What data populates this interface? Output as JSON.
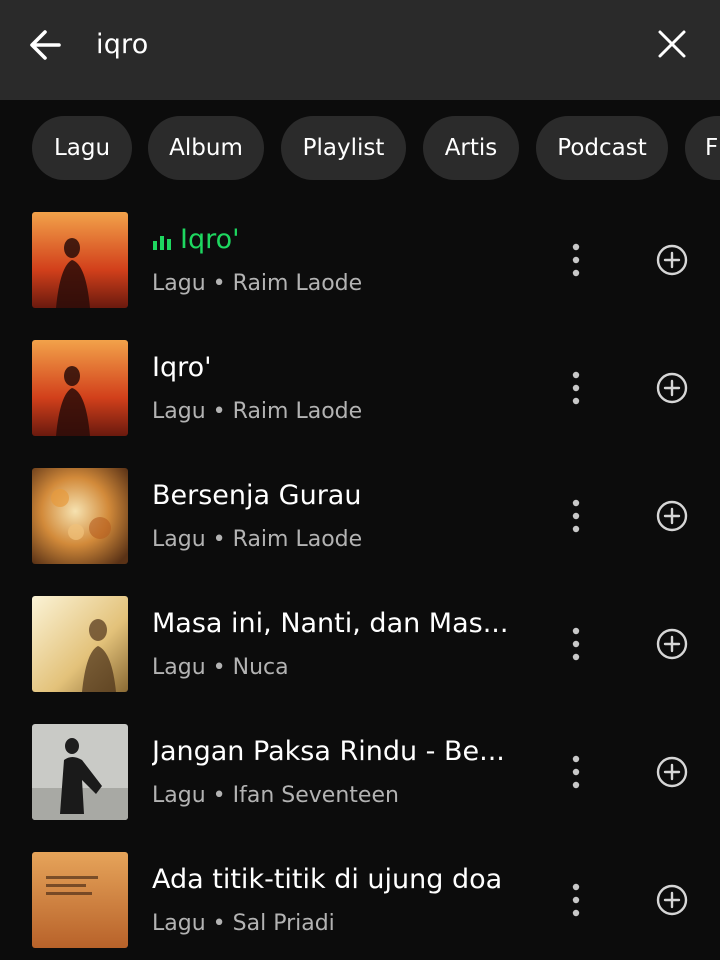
{
  "search": {
    "query": "iqro"
  },
  "filters": [
    "Lagu",
    "Album",
    "Playlist",
    "Artis",
    "Podcast",
    "F"
  ],
  "results": [
    {
      "title": "Iqro'",
      "type": "Lagu",
      "separator": "•",
      "artist": "Raim Laode",
      "playing": true
    },
    {
      "title": "Iqro'",
      "type": "Lagu",
      "separator": "•",
      "artist": "Raim Laode",
      "playing": false
    },
    {
      "title": "Bersenja Gurau",
      "type": "Lagu",
      "separator": "•",
      "artist": "Raim Laode",
      "playing": false
    },
    {
      "title": "Masa ini, Nanti, dan Mas...",
      "type": "Lagu",
      "separator": "•",
      "artist": "Nuca",
      "playing": false
    },
    {
      "title": "Jangan Paksa Rindu - Be...",
      "type": "Lagu",
      "separator": "•",
      "artist": "Ifan Seventeen",
      "playing": false
    },
    {
      "title": "Ada titik-titik di ujung doa",
      "type": "Lagu",
      "separator": "•",
      "artist": "Sal Priadi",
      "playing": false
    }
  ],
  "colors": {
    "accent": "#1ed760",
    "topbar": "#2a2a2a",
    "chip": "#2b2b2b",
    "background": "#0c0c0c",
    "subtitle": "#b3b3b3"
  },
  "icons": {
    "back": "arrow-left-icon",
    "clear": "close-icon",
    "playing": "equalizer-icon",
    "more": "more-vertical-icon",
    "add": "add-circle-icon"
  }
}
